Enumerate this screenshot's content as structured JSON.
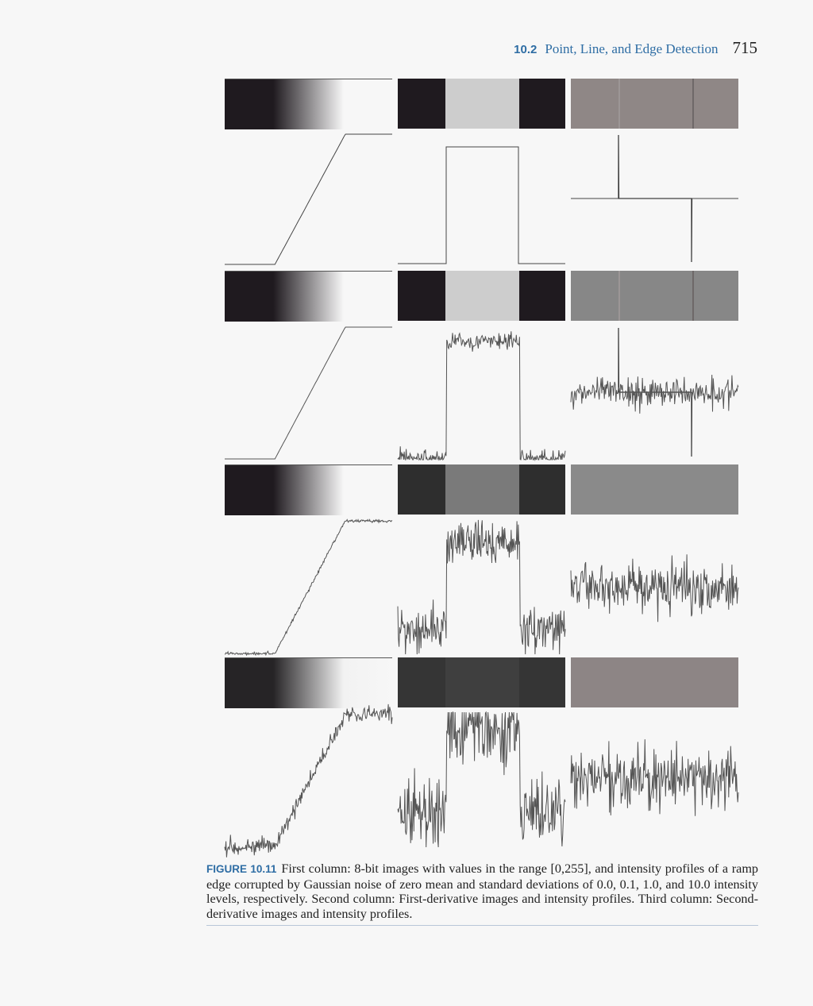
{
  "header": {
    "section_number": "10.2",
    "section_title": "Point, Line, and Edge Detection",
    "page_number": "715"
  },
  "figure": {
    "label": "FIGURE 10.11",
    "caption": "First column: 8-bit images with values in the range [0,255], and intensity profiles of a ramp edge corrupted by Gaussian noise of zero mean and standard deviations of 0.0, 0.1, 1.0, and 10.0 intensity levels, respectively. Second column: First-derivative images and intensity profiles. Third column: Second-derivative images and intensity profiles.",
    "columns": [
      "ramp-edge",
      "first-derivative",
      "second-derivative"
    ],
    "noise_std_levels": [
      0.0,
      0.1,
      1.0,
      10.0
    ]
  },
  "chart_data": {
    "type": "line",
    "title": "",
    "panels": "4 noise levels x 3 columns (image strip + intensity profile)",
    "noise_std": [
      0.0,
      0.1,
      1.0,
      10.0
    ],
    "ramp_profile": {
      "x": [
        0,
        30,
        72,
        100
      ],
      "y": [
        0,
        0,
        1,
        1
      ]
    },
    "first_derivative_profile": {
      "x": [
        0,
        29,
        29,
        73,
        73,
        100
      ],
      "y": [
        0,
        0,
        1,
        1,
        0,
        0
      ]
    },
    "second_derivative_profile": {
      "x": [
        0,
        29,
        29.5,
        73,
        73.5,
        100
      ],
      "y": [
        0,
        0,
        1,
        0,
        -1,
        0
      ]
    }
  }
}
